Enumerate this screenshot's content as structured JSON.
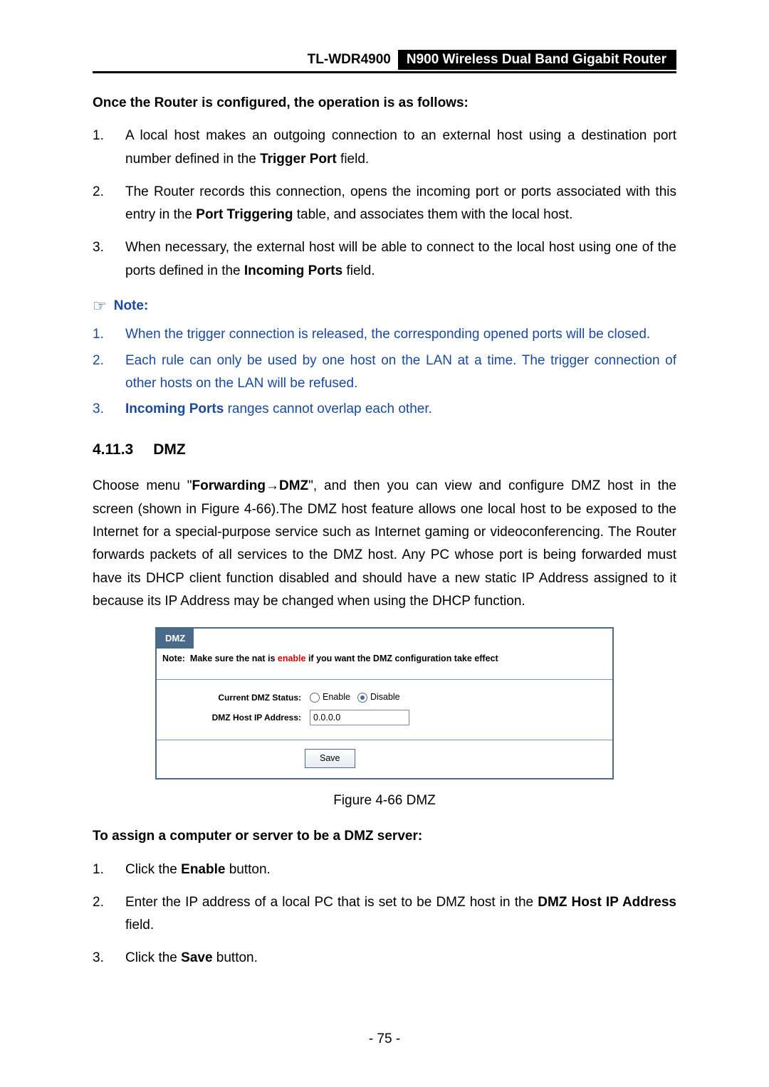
{
  "header": {
    "model": "TL-WDR4900",
    "product": "N900 Wireless Dual Band Gigabit Router"
  },
  "introTitle": "Once the Router is configured, the operation is as follows:",
  "opSteps": [
    {
      "pre": "A local host makes an outgoing connection to an external host using a destination port number defined in the ",
      "bold": "Trigger Port",
      "post": " field."
    },
    {
      "pre": "The Router records this connection, opens the incoming port or ports associated with this entry in the ",
      "bold": "Port Triggering",
      "post": " table, and associates them with the local host."
    },
    {
      "pre": "When necessary, the external host will be able to connect to the local host using one of the ports defined in the ",
      "bold": "Incoming Ports",
      "post": " field."
    }
  ],
  "noteLabel": "Note:",
  "noteItems": [
    {
      "plain": "When the trigger connection is released, the corresponding opened ports will be closed."
    },
    {
      "plain": "Each rule can only be used by one host on the LAN at a time. The trigger connection of other hosts on the LAN will be refused."
    },
    {
      "bold": "Incoming Ports",
      "post": " ranges cannot overlap each other."
    }
  ],
  "section": {
    "num": "4.11.3",
    "title": "DMZ"
  },
  "para": {
    "t1": "Choose menu \"",
    "b1": "Forwarding",
    "arrow": "→",
    "b2": "DMZ",
    "t2": "\", and then you can view and configure DMZ host in the screen (shown in Figure 4-66).The DMZ host feature allows one local host to be exposed to the Internet for a special-purpose service such as Internet gaming or videoconferencing. The Router forwards packets of all services to the DMZ host. Any PC whose port is being forwarded must have its DHCP client function disabled and should have a new static IP Address assigned to it because its IP Address may be changed when using the DHCP function."
  },
  "dmz": {
    "tab": "DMZ",
    "noteLabel": "Note:",
    "noteText1": "Make sure the nat is ",
    "noteEnable": "enable",
    "noteText2": " if you want the DMZ configuration take effect",
    "statusLabel": "Current DMZ Status:",
    "enableLabel": "Enable",
    "disableLabel": "Disable",
    "ipLabel": "DMZ Host IP Address:",
    "ipValue": "0.0.0.0",
    "saveLabel": "Save"
  },
  "figureCaption": "Figure 4-66 DMZ",
  "assignTitle": "To assign a computer or server to be a DMZ server:",
  "assignSteps": [
    {
      "pre": "Click the ",
      "bold": "Enable",
      "post": " button."
    },
    {
      "pre": "Enter the IP address of a local PC that is set to be DMZ host in the ",
      "bold": "DMZ Host IP Address",
      "post": " field."
    },
    {
      "pre": "Click the ",
      "bold": "Save",
      "post": " button."
    }
  ],
  "pageNum": "- 75 -",
  "chart_data": {
    "type": "table",
    "title": "DMZ configuration",
    "fields": [
      {
        "label": "Current DMZ Status",
        "options": [
          "Enable",
          "Disable"
        ],
        "selected": "Disable"
      },
      {
        "label": "DMZ Host IP Address",
        "value": "0.0.0.0"
      }
    ],
    "actions": [
      "Save"
    ]
  }
}
